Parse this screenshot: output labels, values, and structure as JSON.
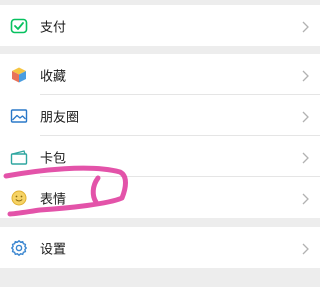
{
  "menu": {
    "pay": {
      "label": "支付",
      "icon": "pay-icon"
    },
    "favorites": {
      "label": "收藏",
      "icon": "favorites-cube-icon"
    },
    "moments": {
      "label": "朋友圈",
      "icon": "moments-photo-icon"
    },
    "cards": {
      "label": "卡包",
      "icon": "card-wallet-icon"
    },
    "stickers": {
      "label": "表情",
      "icon": "sticker-smiley-icon"
    },
    "settings": {
      "label": "设置",
      "icon": "gear-icon"
    }
  },
  "colors": {
    "background": "#ededed",
    "row_background": "#ffffff",
    "pay_green": "#07c160",
    "moments_blue": "#2a78c8",
    "gear_blue": "#3a86d0",
    "annotation_pink": "#e040a0"
  }
}
